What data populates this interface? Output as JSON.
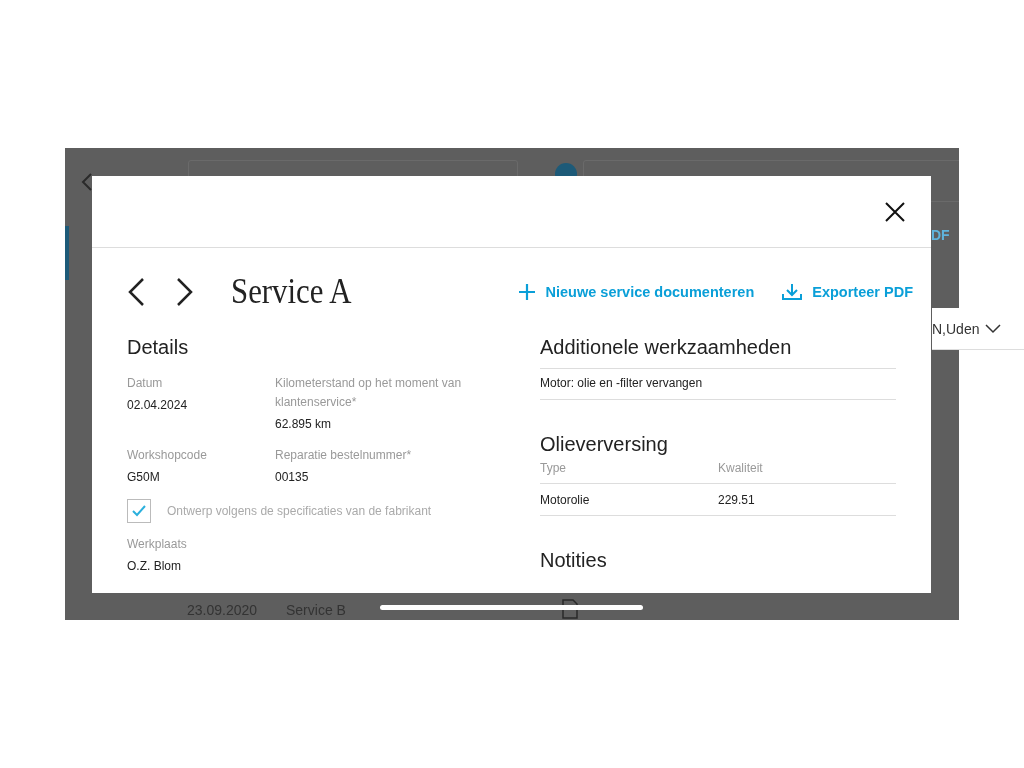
{
  "background": {
    "location": "N,Uden",
    "action_fragment": "DF",
    "row": {
      "date": "23.09.2020",
      "service": "Service B"
    }
  },
  "modal": {
    "title": "Service A",
    "actions": [
      {
        "kind": "add",
        "label": "Nieuwe service documenteren"
      },
      {
        "kind": "export",
        "label": "Exporteer PDF"
      }
    ],
    "details": {
      "heading": "Details",
      "fields": [
        {
          "label": "Datum",
          "value": "02.04.2024"
        },
        {
          "label": "Kilometerstand op het moment van klantenservice*",
          "value": "62.895 km"
        },
        {
          "label": "Workshopcode",
          "value": "G50M"
        },
        {
          "label": "Reparatie bestelnummer*",
          "value": "00135"
        }
      ],
      "checkbox": {
        "label": "Ontwerp volgens de specificaties van de fabrikant",
        "checked": true
      },
      "workshop": {
        "label": "Werkplaats",
        "value": "O.Z. Blom"
      }
    },
    "additional": {
      "heading": "Additionele werkzaamheden",
      "items": [
        "Motor: olie en -filter vervangen"
      ]
    },
    "oil_change": {
      "heading": "Olieverversing",
      "columns": [
        "Type",
        "Kwaliteit"
      ],
      "rows": [
        [
          "Motorolie",
          "229.51"
        ]
      ]
    },
    "notes": {
      "heading": "Notities"
    }
  }
}
